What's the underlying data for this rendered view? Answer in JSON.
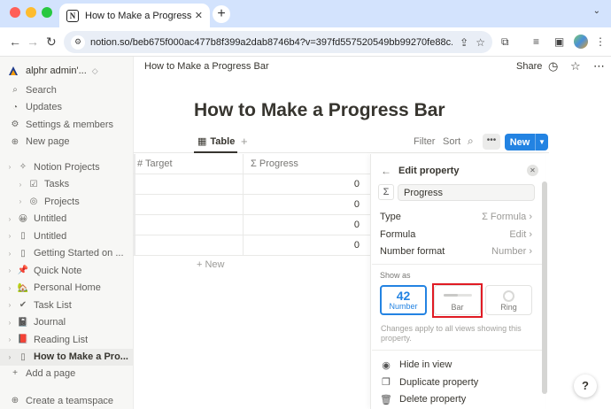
{
  "browser": {
    "tab_title": "How to Make a Progress Bar",
    "tab_favicon": "N",
    "tab_close": "✕",
    "new_tab": "+",
    "url": "notion.so/beb675f000ac477b8f399a2dab8746b4?v=397fd557520549bb99270fe88c...",
    "back": "←",
    "forward": "→",
    "reload": "↻"
  },
  "sidebar": {
    "workspace": "alphr admin'...",
    "top_items": [
      {
        "icon": "search-icon",
        "glyph": "⌕",
        "label": "Search"
      },
      {
        "icon": "updates-icon",
        "glyph": "◔",
        "label": "Updates"
      },
      {
        "icon": "gear-icon",
        "glyph": "⚙",
        "label": "Settings & members"
      },
      {
        "icon": "plus-circle-icon",
        "glyph": "⊕",
        "label": "New page"
      }
    ],
    "pages": [
      {
        "glyph": "✧",
        "label": "Notion Projects",
        "arrow": "›"
      },
      {
        "glyph": "☑",
        "label": "Tasks",
        "arrow": "›"
      },
      {
        "glyph": "◎",
        "label": "Projects",
        "arrow": "›"
      },
      {
        "glyph": "😀",
        "label": "Untitled",
        "arrow": "›"
      },
      {
        "glyph": "▯",
        "label": "Untitled",
        "arrow": "›"
      },
      {
        "glyph": "▯",
        "label": "Getting Started on ...",
        "arrow": "›"
      },
      {
        "glyph": "📌",
        "label": "Quick Note",
        "arrow": "›"
      },
      {
        "glyph": "🏡",
        "label": "Personal Home",
        "arrow": "›"
      },
      {
        "glyph": "✔",
        "label": "Task List",
        "arrow": "›"
      },
      {
        "glyph": "📓",
        "label": "Journal",
        "arrow": "›"
      },
      {
        "glyph": "📕",
        "label": "Reading List",
        "arrow": "›"
      },
      {
        "glyph": "▯",
        "label": "How to Make a Pro...",
        "arrow": "›"
      }
    ],
    "add_page": "Add a page",
    "create_teamspace": "Create a teamspace"
  },
  "header": {
    "breadcrumb": "How to Make a Progress Bar",
    "share": "Share"
  },
  "page": {
    "title": "How to Make a Progress Bar"
  },
  "database": {
    "view_tab": "Table",
    "filter": "Filter",
    "sort": "Sort",
    "more": "•••",
    "new_button": "New",
    "columns": [
      "# Target",
      "Σ Progress"
    ],
    "rows": [
      {
        "progress": "0"
      },
      {
        "progress": "0"
      },
      {
        "progress": "0"
      },
      {
        "progress": "0"
      }
    ],
    "add_row": "+ New"
  },
  "edit_property": {
    "title": "Edit property",
    "name_value": "Progress",
    "type_label": "Type",
    "type_value": "Σ Formula ›",
    "formula_label": "Formula",
    "formula_value": "Edit ›",
    "number_format_label": "Number format",
    "number_format_value": "Number ›",
    "show_as_label": "Show as",
    "options": [
      {
        "preview": "42",
        "label": "Number",
        "selected": true
      },
      {
        "label": "Bar",
        "selected": false,
        "bar_fill": 0.5
      },
      {
        "label": "Ring",
        "selected": false
      }
    ],
    "note": "Changes apply to all views showing this property.",
    "actions": [
      {
        "glyph": "◉",
        "label": "Hide in view"
      },
      {
        "glyph": "❐",
        "label": "Duplicate property"
      },
      {
        "glyph": "🗑",
        "label": "Delete property"
      }
    ]
  },
  "help": "?",
  "colors": {
    "accent": "#2383e2",
    "highlight": "#e01b24",
    "tabstrip": "#d3e3fd"
  }
}
